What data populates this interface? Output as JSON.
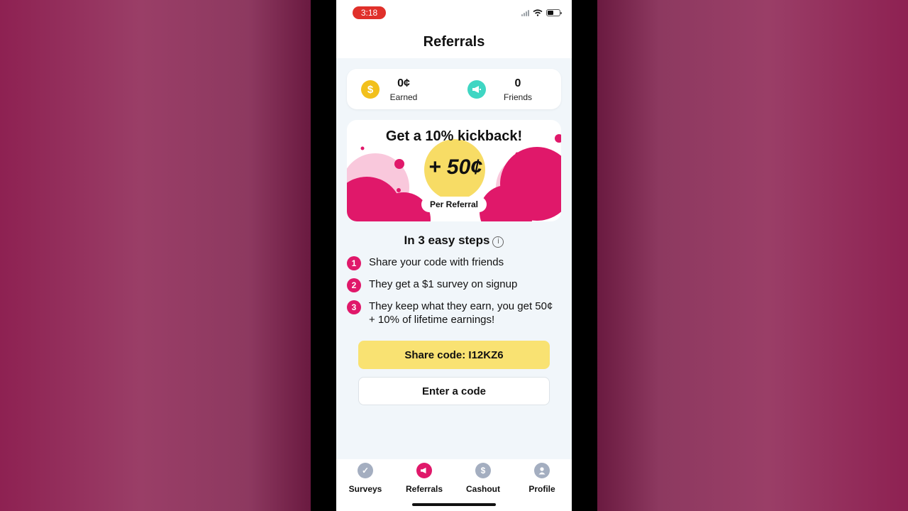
{
  "status_bar": {
    "time": "3:18"
  },
  "header": {
    "title": "Referrals"
  },
  "stats": {
    "earned_value": "0¢",
    "earned_label": "Earned",
    "friends_value": "0",
    "friends_label": "Friends"
  },
  "promo": {
    "title": "Get a 10% kickback!",
    "amount": "+ 50¢",
    "badge": "Per Referral"
  },
  "steps": {
    "title": "In 3 easy steps",
    "items": [
      {
        "num": "1",
        "text": "Share your code with friends"
      },
      {
        "num": "2",
        "text": "They get a $1 survey on signup"
      },
      {
        "num": "3",
        "text": "They keep what they earn, you get 50¢ + 10% of lifetime earnings!"
      }
    ]
  },
  "buttons": {
    "share": "Share code: I12KZ6",
    "enter": "Enter a code"
  },
  "tabs": [
    {
      "label": "Surveys",
      "icon": "check-icon",
      "active": false
    },
    {
      "label": "Referrals",
      "icon": "megaphone-icon",
      "active": true
    },
    {
      "label": "Cashout",
      "icon": "dollar-icon",
      "active": false
    },
    {
      "label": "Profile",
      "icon": "person-icon",
      "active": false
    }
  ],
  "colors": {
    "accent": "#e0186a",
    "share_button": "#f9e272",
    "coin": "#f2c01c",
    "friends_icon": "#3fd6c3",
    "tab_inactive": "#a4aec0"
  }
}
